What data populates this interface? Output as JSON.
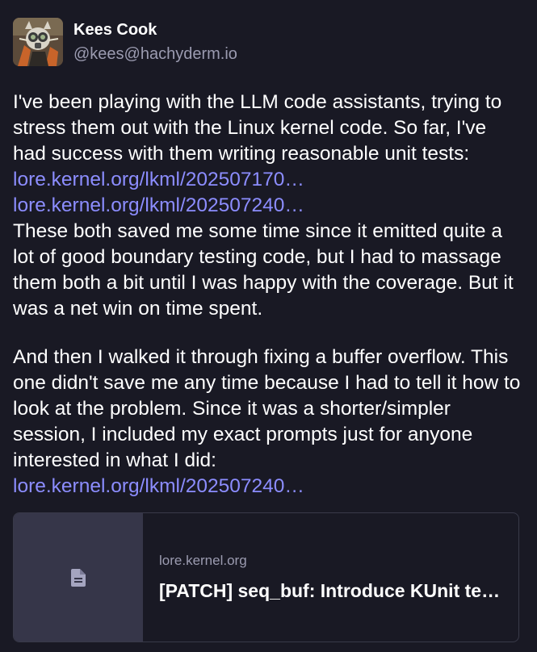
{
  "author": {
    "display_name": "Kees Cook",
    "handle": "@kees@hachyderm.io",
    "avatar_icon": "avatar-image"
  },
  "content": {
    "p1_text1": "I've been playing with the LLM code assistants, trying to stress them out with the Linux kernel code. So far, I've had success with them writing reasonable unit tests:",
    "link1": "lore.kernel.org/lkml/202507170…",
    "link2": "lore.kernel.org/lkml/202507240…",
    "p1_text2": "These both saved me some time since it emitted quite a lot of good boundary testing code, but I had to massage them both a bit until I was happy with the coverage. But it was a net win on time spent.",
    "p2_text1": "And then I walked it through fixing a buffer overflow. This one didn't save me any time because I had to tell it how to look at the problem. Since it was a shorter/simpler session, I included my exact prompts just for anyone interested in what I did:",
    "link3": "lore.kernel.org/lkml/202507240…"
  },
  "card": {
    "host": "lore.kernel.org",
    "title": "[PATCH] seq_buf: Introduce KUnit tests",
    "thumb_icon": "document-icon"
  },
  "colors": {
    "background": "#191924",
    "link": "#8c8dff",
    "muted": "#9b9bb0",
    "card_border": "#393a49",
    "card_thumb": "#363649"
  }
}
